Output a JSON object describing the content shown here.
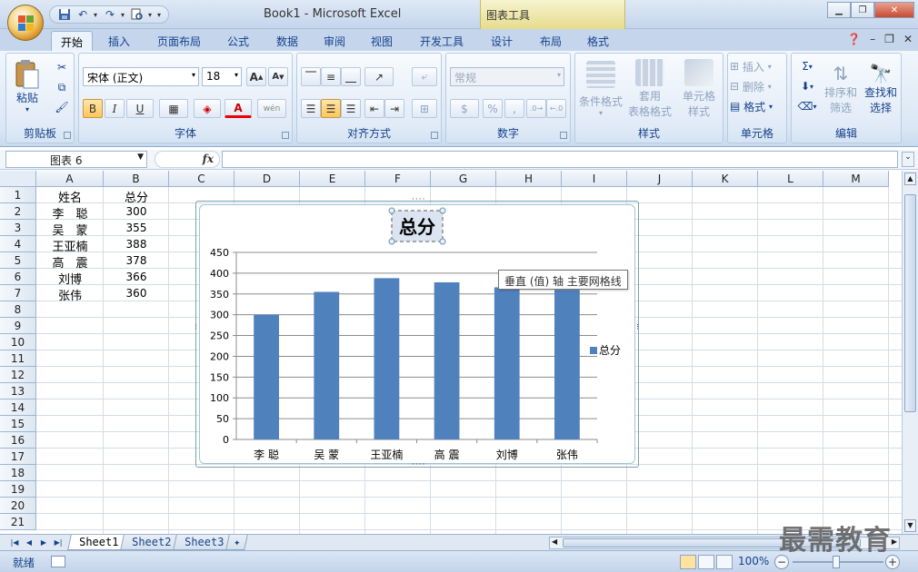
{
  "window": {
    "title": "Book1 - Microsoft Excel",
    "contextual_tab_title": "图表工具"
  },
  "ribbon_tabs": [
    "开始",
    "插入",
    "页面布局",
    "公式",
    "数据",
    "审阅",
    "视图",
    "开发工具",
    "设计",
    "布局",
    "格式"
  ],
  "ribbon": {
    "clipboard": {
      "label": "剪贴板",
      "paste": "粘贴"
    },
    "font": {
      "label": "字体",
      "font_name": "宋体 (正文)",
      "font_size": "18",
      "bold": "B",
      "italic": "I",
      "underline": "U",
      "font_color_glyph": "A",
      "phonetic_glyph": "wén"
    },
    "alignment": {
      "label": "对齐方式"
    },
    "number": {
      "label": "数字",
      "format": "常规"
    },
    "styles": {
      "label": "样式",
      "conditional": "条件格式",
      "table_format_1": "套用",
      "table_format_2": "表格格式",
      "cell_style_1": "单元格",
      "cell_style_2": "样式"
    },
    "cells": {
      "label": "单元格",
      "insert": "插入",
      "delete": "删除",
      "format": "格式"
    },
    "editing": {
      "label": "编辑",
      "sort_1": "排序和",
      "sort_2": "筛选",
      "find_1": "查找和",
      "find_2": "选择"
    }
  },
  "formula_bar": {
    "name_box": "图表 6",
    "fx": "fx",
    "formula": ""
  },
  "columns": [
    "A",
    "B",
    "C",
    "D",
    "E",
    "F",
    "G",
    "H",
    "I",
    "J",
    "K",
    "L",
    "M"
  ],
  "rows": [
    "1",
    "2",
    "3",
    "4",
    "5",
    "6",
    "7",
    "8",
    "9",
    "10",
    "11",
    "12",
    "13",
    "14",
    "15",
    "16",
    "17",
    "18",
    "19",
    "20",
    "21"
  ],
  "sheet_cells": {
    "header_name": "姓名",
    "header_total": "总分",
    "records": [
      {
        "name": "李　聪",
        "total": "300"
      },
      {
        "name": "吴　蒙",
        "total": "355"
      },
      {
        "name": "王亚楠",
        "total": "388"
      },
      {
        "name": "高　震",
        "total": "378"
      },
      {
        "name": "刘博",
        "total": "366"
      },
      {
        "name": "张伟",
        "total": "360"
      }
    ]
  },
  "chart_data": {
    "type": "bar",
    "title": "总分",
    "categories": [
      "李 聪",
      "吴 蒙",
      "王亚楠",
      "高 震",
      "刘博",
      "张伟"
    ],
    "series": [
      {
        "name": "总分",
        "values": [
          300,
          355,
          388,
          378,
          366,
          360
        ],
        "color": "#4f81bd"
      }
    ],
    "ylim": [
      0,
      450
    ],
    "yticks": [
      "0",
      "50",
      "100",
      "150",
      "200",
      "250",
      "300",
      "350",
      "400",
      "450"
    ],
    "grid": true,
    "legend": "right"
  },
  "tooltip": "垂直 (值) 轴 主要网格线",
  "sheet_tabs": [
    "Sheet1",
    "Sheet2",
    "Sheet3"
  ],
  "status": {
    "ready": "就绪",
    "zoom": "100%"
  },
  "watermark": "最需教育"
}
